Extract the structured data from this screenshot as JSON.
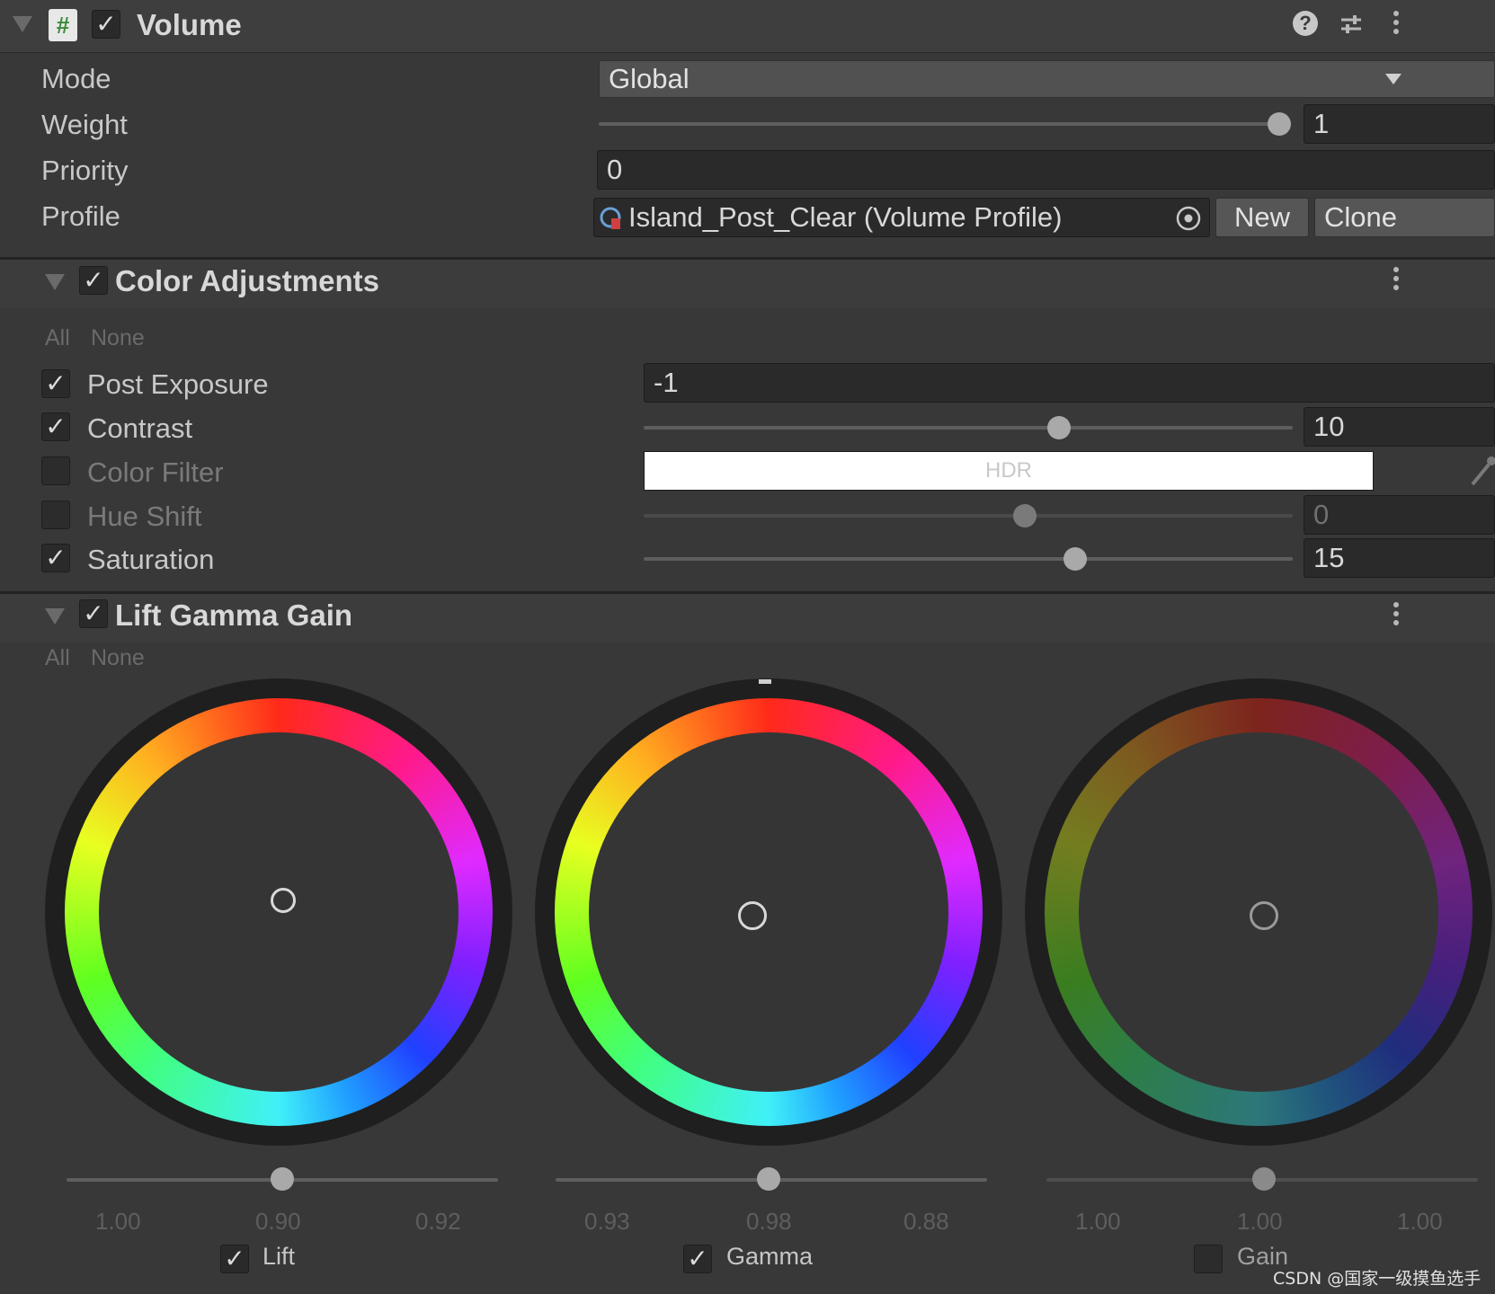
{
  "component": {
    "title": "Volume",
    "icons": [
      "script-icon",
      "help-icon",
      "preset-icon",
      "kebab-icon"
    ]
  },
  "mode": {
    "label": "Mode",
    "value": "Global"
  },
  "weight": {
    "label": "Weight",
    "value": "1",
    "fraction": 1.0
  },
  "priority": {
    "label": "Priority",
    "value": "0"
  },
  "profile": {
    "label": "Profile",
    "value": "Island_Post_Clear (Volume Profile)",
    "new_label": "New",
    "clone_label": "Clone"
  },
  "color_adjustments": {
    "title": "Color Adjustments",
    "all_label": "All",
    "none_label": "None",
    "post_exposure": {
      "label": "Post Exposure",
      "value": "-1",
      "enabled": true
    },
    "contrast": {
      "label": "Contrast",
      "value": "10",
      "enabled": true,
      "fraction": 0.55
    },
    "color_filter": {
      "label": "Color Filter",
      "value": "HDR",
      "enabled": false,
      "color": "#ffffff"
    },
    "hue_shift": {
      "label": "Hue Shift",
      "value": "0",
      "enabled": false,
      "fraction": 0.5
    },
    "saturation": {
      "label": "Saturation",
      "value": "15",
      "enabled": true,
      "fraction": 0.575
    }
  },
  "lift_gamma_gain": {
    "title": "Lift Gamma Gain",
    "all_label": "All",
    "none_label": "None",
    "wheels": [
      {
        "label": "Lift",
        "enabled": true,
        "values": [
          "1.00",
          "0.90",
          "0.92"
        ],
        "slider_fraction": 0.5
      },
      {
        "label": "Gamma",
        "enabled": true,
        "values": [
          "0.93",
          "0.98",
          "0.88"
        ],
        "slider_fraction": 0.5
      },
      {
        "label": "Gain",
        "enabled": false,
        "values": [
          "1.00",
          "1.00",
          "1.00"
        ],
        "slider_fraction": 0.5
      }
    ]
  },
  "watermark": "CSDN @国家一级摸鱼选手"
}
